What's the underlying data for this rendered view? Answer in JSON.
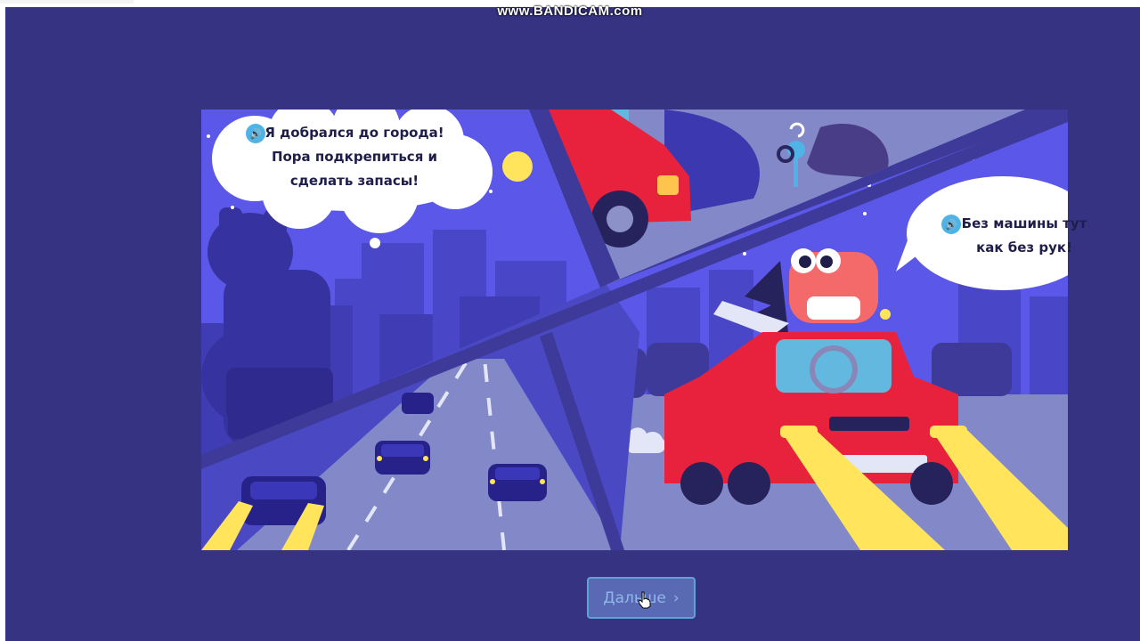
{
  "watermark": {
    "text": "www.BANDICAM.com"
  },
  "comic": {
    "bubble_left": {
      "line1": "Я добрался до города!",
      "line2": "Пора подкрепиться и",
      "line3": "сделать запасы!"
    },
    "bubble_right": {
      "line1": "Без машины тут",
      "line2": "как без рук!"
    }
  },
  "navigation": {
    "next_label": "Дальше",
    "next_icon": "chevron-right-icon"
  },
  "icons": {
    "speaker": "speaker-icon",
    "cursor": "hand-pointer-icon"
  },
  "colors": {
    "background": "#363383",
    "panel_sky": "#5a55e6",
    "car_red": "#e8223c",
    "headlight": "#ffe45c",
    "button_border": "#5aa4d8"
  }
}
